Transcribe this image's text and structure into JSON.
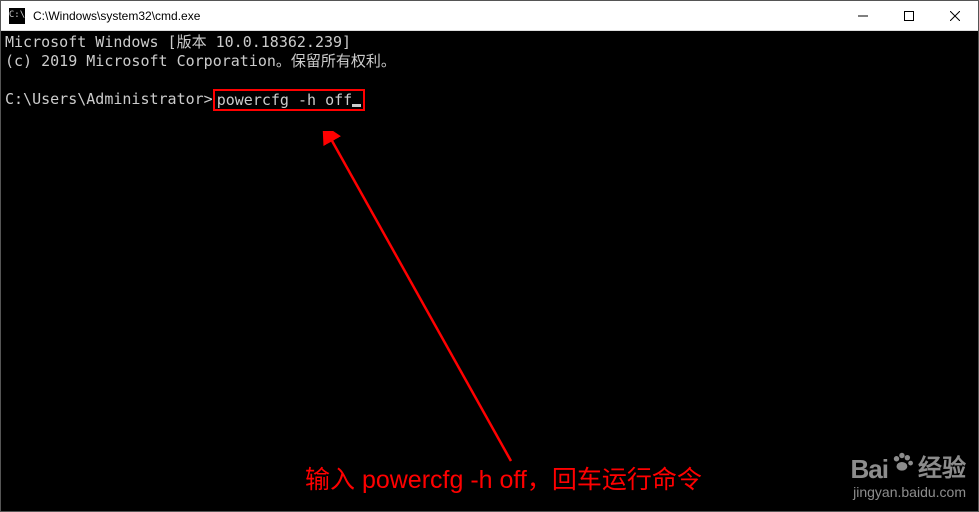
{
  "titlebar": {
    "icon_label": "C:\\",
    "title": "C:\\Windows\\system32\\cmd.exe"
  },
  "terminal": {
    "line1": "Microsoft Windows [版本 10.0.18362.239]",
    "line2": "(c) 2019 Microsoft Corporation。保留所有权利。",
    "prompt": "C:\\Users\\Administrator>",
    "command": "powercfg -h off"
  },
  "annotation": {
    "text": "输入 powercfg -h off，回车运行命令"
  },
  "watermark": {
    "brand": "Bai",
    "brand_cn": "经验",
    "url": "jingyan.baidu.com"
  }
}
